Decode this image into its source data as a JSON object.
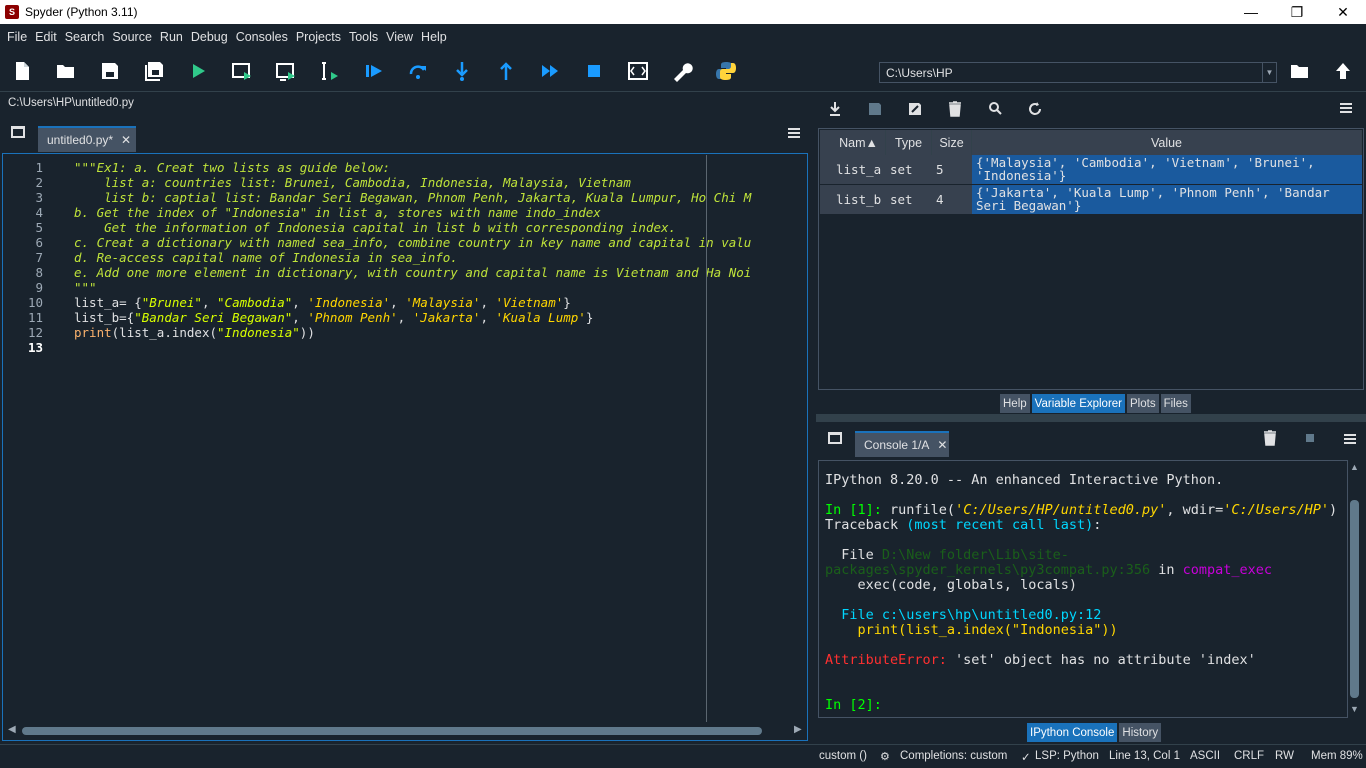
{
  "window": {
    "title": "Spyder (Python 3.11)",
    "minimize": "—",
    "maximize": "❐",
    "close": "✕"
  },
  "menu": [
    "File",
    "Edit",
    "Search",
    "Source",
    "Run",
    "Debug",
    "Consoles",
    "Projects",
    "Tools",
    "View",
    "Help"
  ],
  "toolbar": {
    "path": "C:\\Users\\HP"
  },
  "editor": {
    "file_path": "C:\\Users\\HP\\untitled0.py",
    "tab_label": "untitled0.py*",
    "current_line": 13,
    "line_numbers": [
      "1",
      "2",
      "3",
      "4",
      "5",
      "6",
      "7",
      "8",
      "9",
      "10",
      "11",
      "12",
      "13"
    ],
    "lines": {
      "l1": "\"\"\"Ex1: a. Creat two lists as guide below:",
      "l2": "    list a: countries list: Brunei, Cambodia, Indonesia, Malaysia, Vietnam",
      "l3": "    list b: captial list: Bandar Seri Begawan, Phnom Penh, Jakarta, Kuala Lumpur, Ho Chi M",
      "l4": "b. Get the index of \"Indonesia\" in list a, stores with name indo_index",
      "l5": "    Get the information of Indonesia capital in list b with corresponding index.",
      "l6": "c. Creat a dictionary with named sea_info, combine country in key name and capital in valu",
      "l7": "d. Re-access capital name of Indonesia in sea_info.",
      "l8": "e. Add one more element in dictionary, with country and capital name is Vietnam and Ha Noi",
      "l9": "\"\"\"",
      "l10a": "list_a= {",
      "l10s": [
        "\"Brunei\"",
        "\"Cambodia\"",
        "'Indonesia'",
        "'Malaysia'",
        "'Vietnam'"
      ],
      "l10b": "}",
      "l11a": "list_b={",
      "l11s": [
        "\"Bandar Seri Begawan\"",
        "'Phnom Penh'",
        "'Jakarta'",
        "'Kuala Lump'"
      ],
      "l11b": "}",
      "l12a": "print",
      "l12b": "(list_a.index(",
      "l12s": "\"Indonesia\"",
      "l12c": "))"
    }
  },
  "variable_explorer": {
    "columns": [
      "Nam▲",
      "Type",
      "Size",
      "Value"
    ],
    "rows": [
      {
        "name": "list_a",
        "type": "set",
        "size": "5",
        "value": "{'Malaysia', 'Cambodia', 'Vietnam', 'Brunei', 'Indonesia'}"
      },
      {
        "name": "list_b",
        "type": "set",
        "size": "4",
        "value": "{'Jakarta', 'Kuala Lump', 'Phnom Penh', 'Bandar Seri Begawan'}"
      }
    ],
    "tabs": [
      "Help",
      "Variable Explorer",
      "Plots",
      "Files"
    ],
    "active_tab": "Variable Explorer"
  },
  "console": {
    "tab_label": "Console 1/A",
    "banner": "IPython 8.20.0 -- An enhanced Interactive Python.",
    "in1_prompt": "In [1]:",
    "in1_cmd_a": " runfile(",
    "in1_path": "'C:/Users/HP/untitled0.py'",
    "in1_cmd_b": ", wdir=",
    "in1_wdir": "'C:/Users/HP'",
    "in1_cmd_c": ")",
    "tb_a": "Traceback ",
    "tb_b": "(most recent call last)",
    "tb_c": ":",
    "file1_label": "  File ",
    "file1_path": "D:\\New folder\\Lib\\site-",
    "file1_path2": "packages\\spyder_kernels\\py3compat.py:356",
    "file1_in": " in ",
    "file1_func": "compat_exec",
    "file1_code": "    exec(code, globals, locals)",
    "file2_label": "  File ",
    "file2_path": "c:\\users\\hp\\untitled0.py:12",
    "file2_code": "    print(list_a.index(\"Indonesia\"))",
    "err_name": "AttributeError:",
    "err_msg": " 'set' object has no attribute 'index'",
    "in2_prompt": "In [2]:",
    "tabs": [
      "IPython Console",
      "History"
    ],
    "active_tab": "IPython Console"
  },
  "status": {
    "env": "custom ()",
    "completions": "Completions: custom",
    "lsp": "LSP: Python",
    "position": "Line 13, Col 1",
    "encoding": "ASCII",
    "eol": "CRLF",
    "mode": "RW",
    "mem": "Mem 89%"
  },
  "colors": {
    "accent": "#1a72bb",
    "background": "#19232d",
    "panel": "#455364",
    "selection": "#1a5a9e"
  }
}
